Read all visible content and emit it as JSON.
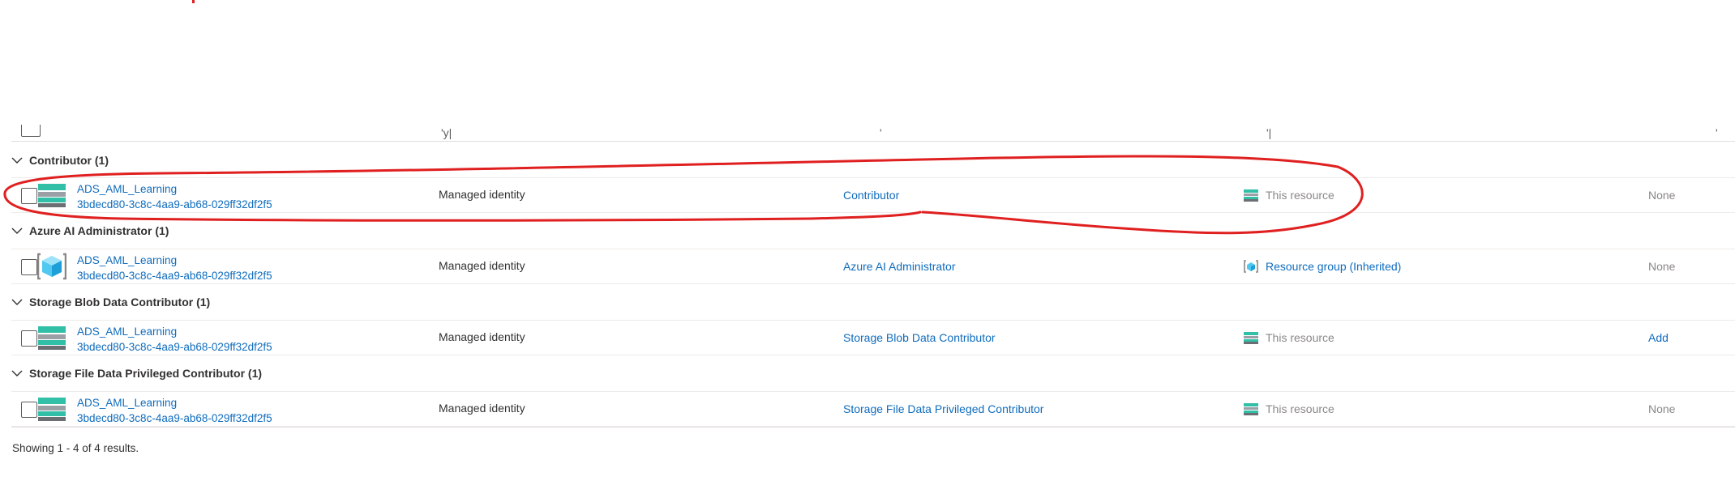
{
  "column_header_fragments": [
    "'y|",
    "'",
    "'|",
    "'"
  ],
  "groups": [
    {
      "title": "Contributor (1)",
      "row": {
        "name": "ADS_AML_Learning",
        "object_id": "3bdecd80-3c8c-4aa9-ab68-029ff32df2f5",
        "type": "Managed identity",
        "role": "Contributor",
        "scope": "This resource",
        "scope_icon": "storage-account-icon",
        "condition": "None",
        "entity_icon": "storage-account-icon"
      }
    },
    {
      "title": "Azure AI Administrator (1)",
      "row": {
        "name": "ADS_AML_Learning",
        "object_id": "3bdecd80-3c8c-4aa9-ab68-029ff32df2f5",
        "type": "Managed identity",
        "role": "Azure AI Administrator",
        "scope": "Resource group (Inherited)",
        "scope_icon": "resource-group-icon",
        "condition": "None",
        "entity_icon": "resource-group-cube-icon"
      }
    },
    {
      "title": "Storage Blob Data Contributor (1)",
      "row": {
        "name": "ADS_AML_Learning",
        "object_id": "3bdecd80-3c8c-4aa9-ab68-029ff32df2f5",
        "type": "Managed identity",
        "role": "Storage Blob Data Contributor",
        "scope": "This resource",
        "scope_icon": "storage-account-icon",
        "condition": "Add",
        "entity_icon": "storage-account-icon"
      }
    },
    {
      "title": "Storage File Data Privileged Contributor (1)",
      "row": {
        "name": "ADS_AML_Learning",
        "object_id": "3bdecd80-3c8c-4aa9-ab68-029ff32df2f5",
        "type": "Managed identity",
        "role": "Storage File Data Privileged Contributor",
        "scope": "This resource",
        "scope_icon": "storage-account-icon",
        "condition": "None",
        "entity_icon": "storage-account-icon"
      }
    }
  ],
  "footer": "Showing 1 - 4 of 4 results.",
  "colors": {
    "link": "#0f6cbd",
    "muted": "#8a8886",
    "storage_teal": "#32bfa7",
    "storage_dark": "#7a7a7a",
    "annotation_red": "#e02020"
  }
}
